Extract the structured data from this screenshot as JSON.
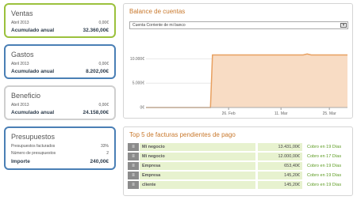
{
  "ventas": {
    "title": "Ventas",
    "period_label": "Abril 2013",
    "period_value": "0,00€",
    "total_label": "Acumulado anual",
    "total_value": "32.360,00€"
  },
  "gastos": {
    "title": "Gastos",
    "period_label": "Abril 2013",
    "period_value": "0,00€",
    "total_label": "Acumulado anual",
    "total_value": "8.202,00€"
  },
  "beneficio": {
    "title": "Beneficio",
    "period_label": "Abril 2013",
    "period_value": "0,00€",
    "total_label": "Acumulado anual",
    "total_value": "24.158,00€"
  },
  "presupuestos": {
    "title": "Presupuestos",
    "row1_label": "Presupuestos facturados",
    "row1_value": "33%",
    "row2_label": "Número de presupuestos",
    "row2_value": "2",
    "total_label": "Importe",
    "total_value": "240,00€"
  },
  "colors": {
    "ventas_border": "#9bc13c",
    "gastos_border": "#4a7fb5",
    "beneficio_border": "#cfcfcf",
    "presupuestos_border": "#4a7fb5",
    "chart_line": "#e8a060",
    "chart_fill": "#f8dcc4"
  },
  "balance": {
    "title": "Balance de cuentas",
    "account_selected": "Cuenta Corriente de mi banco",
    "arrow_icon": "chevron-down-icon"
  },
  "chart_data": {
    "type": "area",
    "y_ticks": [
      "10.000€",
      "5.000€",
      "0€"
    ],
    "x_ticks": [
      "26. Feb",
      "11. Mar",
      "25. Mar"
    ],
    "ylim": [
      0,
      12500
    ],
    "series": [
      {
        "values": [
          [
            0,
            0
          ],
          [
            0.32,
            0
          ],
          [
            0.33,
            10800
          ],
          [
            0.78,
            10800
          ],
          [
            0.8,
            11000
          ],
          [
            0.82,
            10800
          ],
          [
            1,
            10800
          ]
        ]
      }
    ],
    "grid": true
  },
  "facturas": {
    "title": "Top 5 de facturas pendientes de pago",
    "rows": [
      {
        "name": "Mi negocio",
        "amount": "13.431,00€",
        "status": "Cobro en 19 Días"
      },
      {
        "name": "Mi negocio",
        "amount": "12.000,00€",
        "status": "Cobro en 17 Días"
      },
      {
        "name": "Empresa",
        "amount": "653,40€",
        "status": "Cobro en 19 Días"
      },
      {
        "name": "Empresa",
        "amount": "145,20€",
        "status": "Cobro en 19 Días"
      },
      {
        "name": "cliente",
        "amount": "145,20€",
        "status": "Cobro en 19 Días"
      }
    ]
  }
}
